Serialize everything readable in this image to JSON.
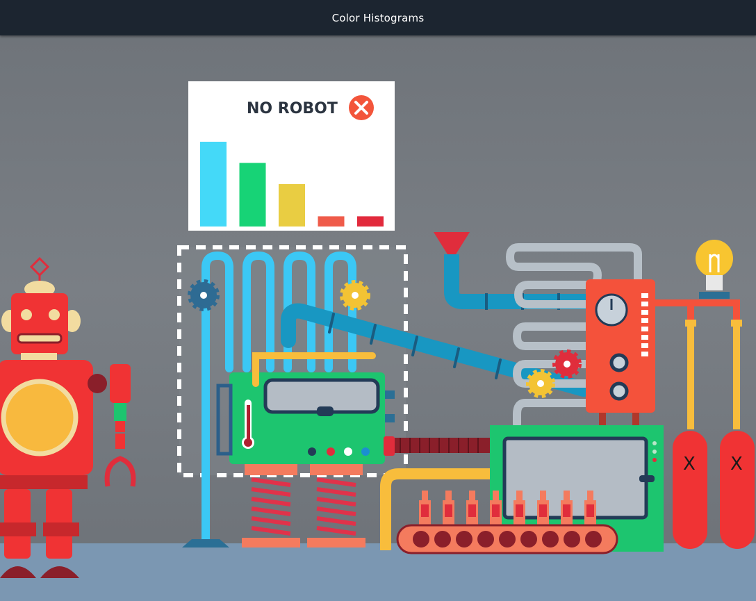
{
  "window": {
    "title": "Color Histograms"
  },
  "histogram_card": {
    "label": "NO ROBOT",
    "status_icon": "close-icon",
    "chart_data": {
      "type": "bar",
      "categories": [
        "cyan",
        "green",
        "yellow",
        "orange",
        "red"
      ],
      "values": [
        1.0,
        0.75,
        0.5,
        0.12,
        0.12
      ],
      "colors": [
        "#44d9f8",
        "#17d376",
        "#e9cd42",
        "#ef5b4a",
        "#e22a3c"
      ],
      "ylim": [
        0,
        1
      ]
    }
  },
  "tanks": {
    "labels": [
      "X",
      "X"
    ]
  },
  "colors": {
    "titlebar": "#1c2530",
    "wall": "#74797f",
    "floor": "#7b97b2",
    "robot_red": "#f03334",
    "machine_green": "#1dc56f",
    "pipe_blue": "#1897c2",
    "panel_orange": "#f4523b"
  }
}
